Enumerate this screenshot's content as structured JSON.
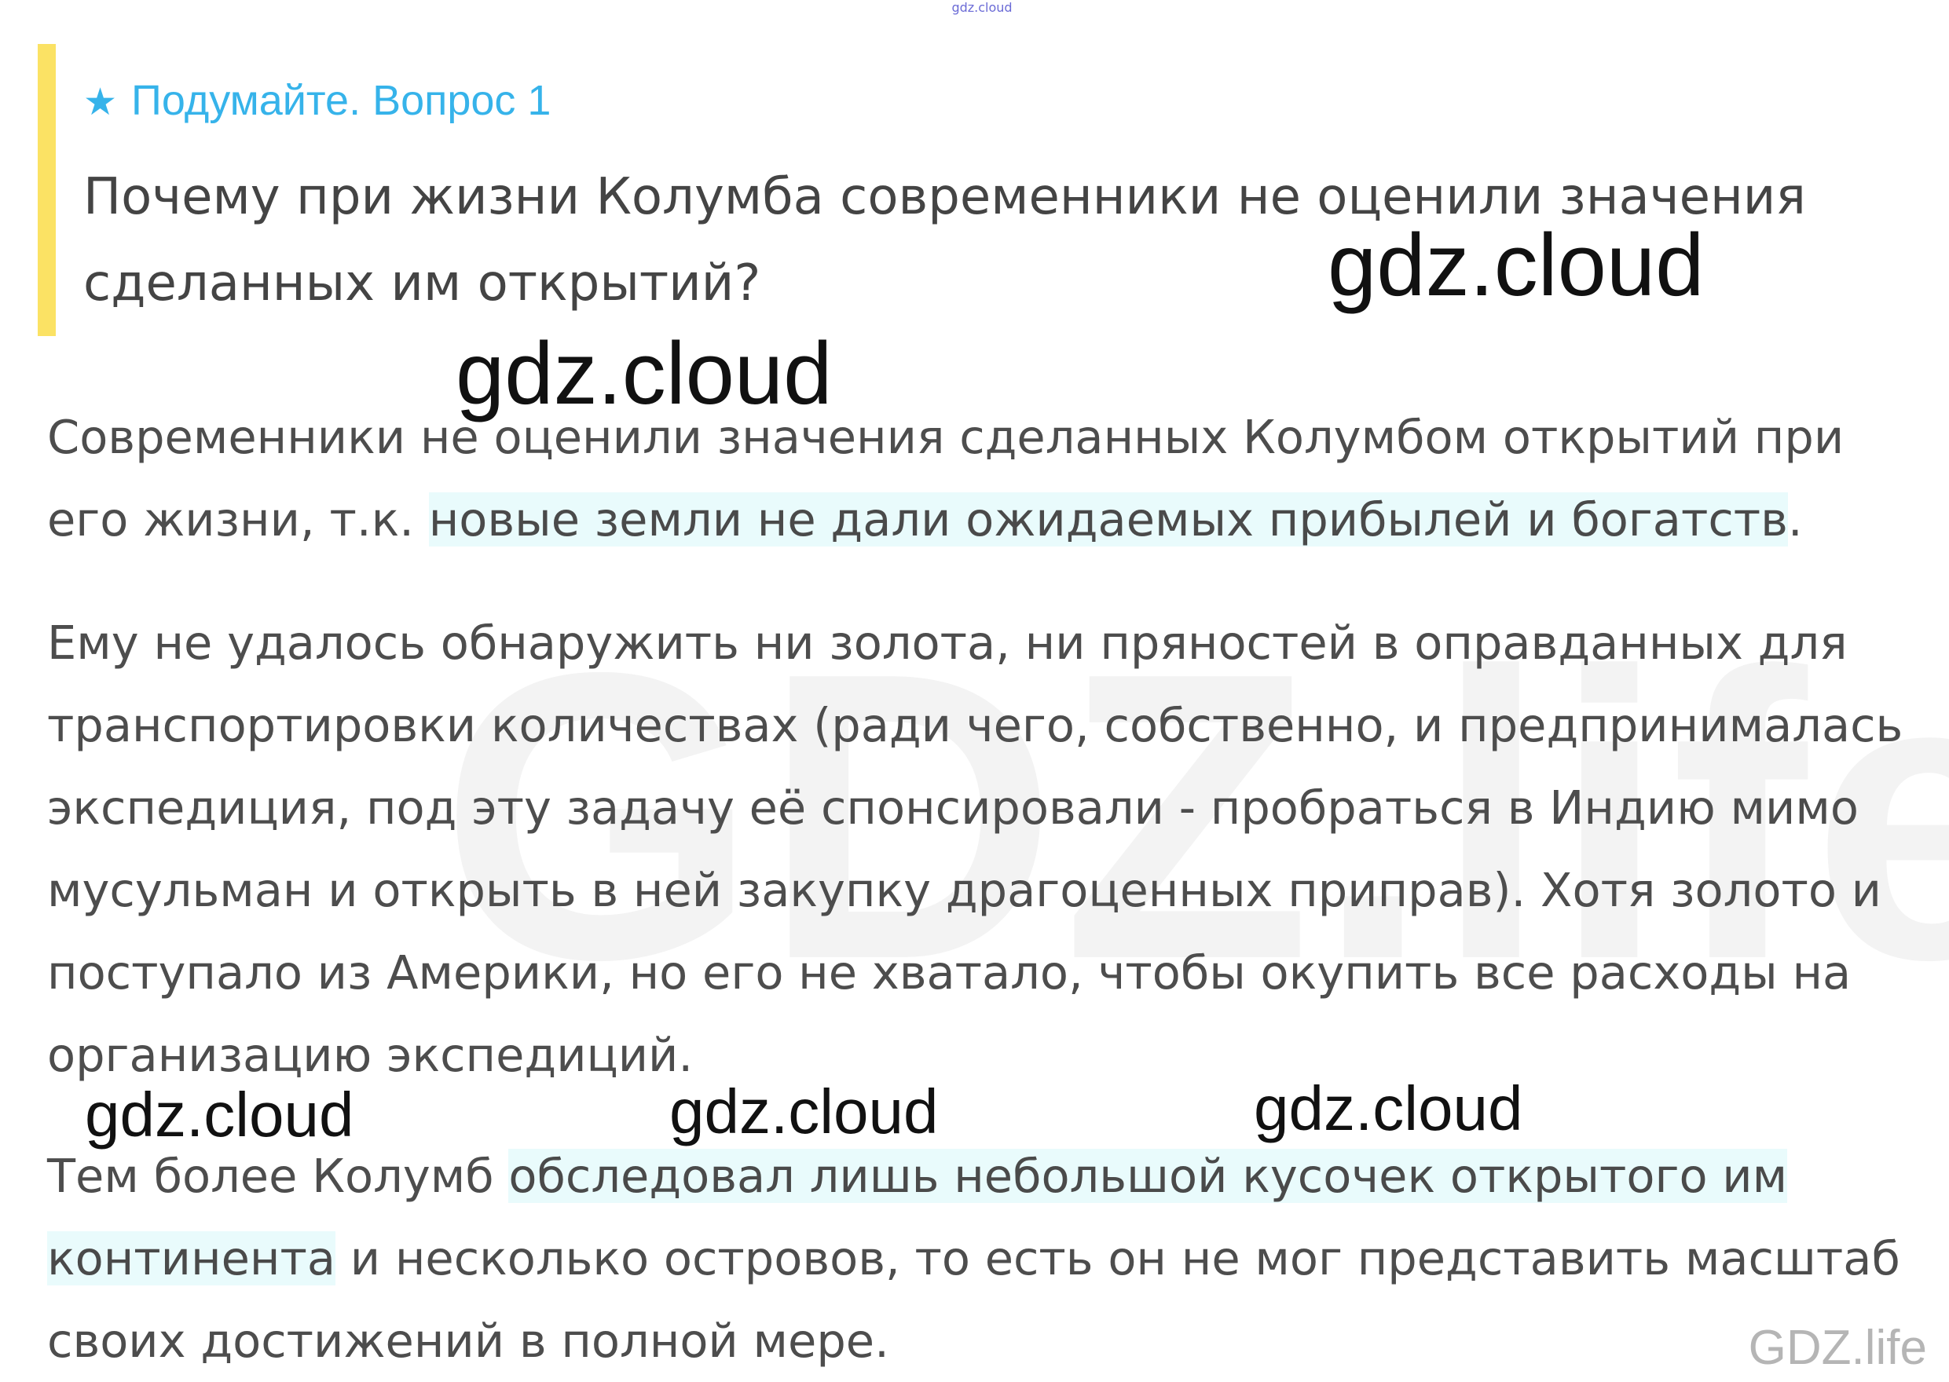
{
  "top_mark": "gdz.cloud",
  "question": {
    "star_icon": "star-icon",
    "heading": "Подумайте. Вопрос 1",
    "text": "Почему при жизни Колумба современники не оценили значения сделанных им открытий?"
  },
  "answer": {
    "p1_plain": "Современники не оценили значения сделанных Колумбом открытий при его жизни, т.к. ",
    "p1_highlight": "новые земли не дали ожидаемых прибылей и богатств",
    "p1_end": ".",
    "p2": "Ему не удалось обнаружить ни золота, ни пряностей в оправданных для транспортировки количествах (ради чего, собственно, и предпринималась экспедиция, под эту задачу её спонсировали - пробраться в Индию мимо мусульман и открыть в ней закупку драгоценных приправ). Хотя золото и поступало из Америки, но его не хватало, чтобы окупить все расходы на организацию экспедиций.",
    "p3_plain": "Тем более Колумб ",
    "p3_highlight": "обследовал лишь небольшой кусочек открытого им континента",
    "p3_end": " и несколько островов, то есть он не мог представить масштаб своих достижений в полной мере."
  },
  "watermarks": {
    "background": "GDZ.life",
    "cloud": "gdz.cloud",
    "life": "GDZ.life"
  },
  "colors": {
    "accent_bar": "#fbe264",
    "heading": "#36b3ea",
    "highlight": "#e9fbfc"
  }
}
